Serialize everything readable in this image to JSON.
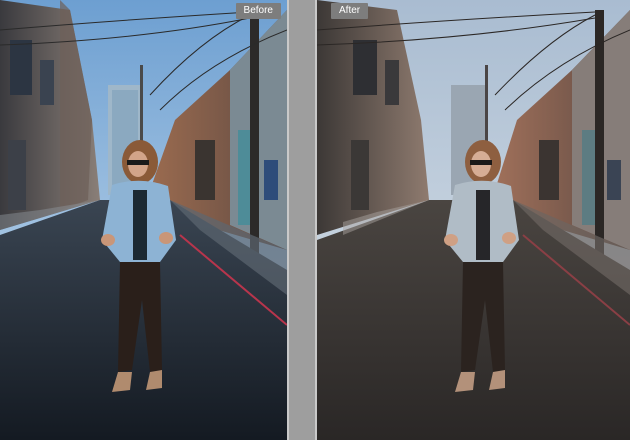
{
  "comparison": {
    "before_label": "Before",
    "after_label": "After"
  },
  "colors": {
    "before_sky": "#8fb7dc",
    "after_sky": "#b9c8da",
    "before_ground": "#27313d",
    "after_ground": "#3d3836",
    "label_bg": "#7d7d7d",
    "divider_bg": "#9e9e9e"
  },
  "image": {
    "subject": "photo-alley-woman"
  }
}
